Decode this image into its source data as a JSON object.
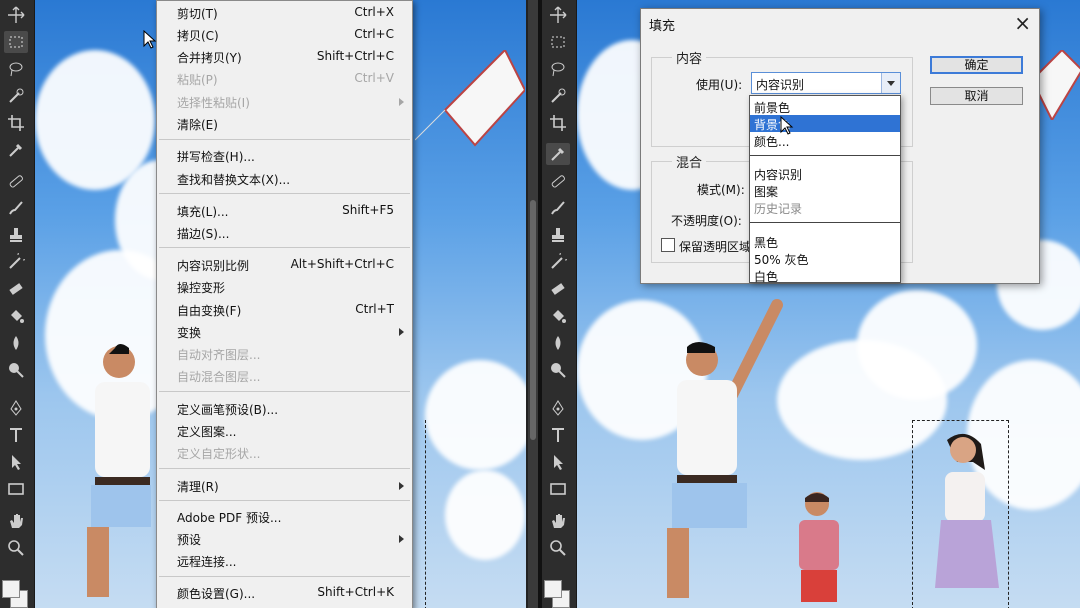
{
  "edit_menu": {
    "items": [
      {
        "label": "剪切(T)",
        "shortcut": "Ctrl+X"
      },
      {
        "label": "拷贝(C)",
        "shortcut": "Ctrl+C"
      },
      {
        "label": "合并拷贝(Y)",
        "shortcut": "Shift+Ctrl+C"
      },
      {
        "label": "粘贴(P)",
        "shortcut": "Ctrl+V"
      },
      {
        "label": "选择性粘贴(I)",
        "shortcut": ""
      },
      {
        "label": "清除(E)",
        "shortcut": ""
      },
      {
        "label": "拼写检查(H)...",
        "shortcut": ""
      },
      {
        "label": "查找和替换文本(X)...",
        "shortcut": ""
      },
      {
        "label": "填充(L)...",
        "shortcut": "Shift+F5"
      },
      {
        "label": "描边(S)...",
        "shortcut": ""
      },
      {
        "label": "内容识别比例",
        "shortcut": "Alt+Shift+Ctrl+C"
      },
      {
        "label": "操控变形",
        "shortcut": ""
      },
      {
        "label": "自由变换(F)",
        "shortcut": "Ctrl+T"
      },
      {
        "label": "变换",
        "shortcut": ""
      },
      {
        "label": "自动对齐图层...",
        "shortcut": ""
      },
      {
        "label": "自动混合图层...",
        "shortcut": ""
      },
      {
        "label": "定义画笔预设(B)...",
        "shortcut": ""
      },
      {
        "label": "定义图案...",
        "shortcut": ""
      },
      {
        "label": "定义自定形状...",
        "shortcut": ""
      },
      {
        "label": "清理(R)",
        "shortcut": ""
      },
      {
        "label": "Adobe PDF 预设...",
        "shortcut": ""
      },
      {
        "label": "预设",
        "shortcut": ""
      },
      {
        "label": "远程连接...",
        "shortcut": ""
      },
      {
        "label": "颜色设置(G)...",
        "shortcut": "Shift+Ctrl+K"
      }
    ]
  },
  "fill_dialog": {
    "title": "填充",
    "close_icon": "close-icon",
    "content_group": "内容",
    "use_label": "使用(U):",
    "use_value": "内容识别",
    "blend_group": "混合",
    "mode_label": "模式(M):",
    "opacity_label": "不透明度(O):",
    "preserve_label": "保留透明区域",
    "ok_label": "确定",
    "cancel_label": "取消",
    "options": [
      {
        "label": "前景色"
      },
      {
        "label": "背景色"
      },
      {
        "label": "颜色..."
      },
      {
        "label": "内容识别"
      },
      {
        "label": "图案"
      },
      {
        "label": "历史记录"
      },
      {
        "label": "黑色"
      },
      {
        "label": "50% 灰色"
      },
      {
        "label": "白色"
      }
    ]
  },
  "colors": {
    "highlight": "#2f73d4",
    "toolbar": "#2d2d2d",
    "menu_bg": "#f0f0f0"
  }
}
